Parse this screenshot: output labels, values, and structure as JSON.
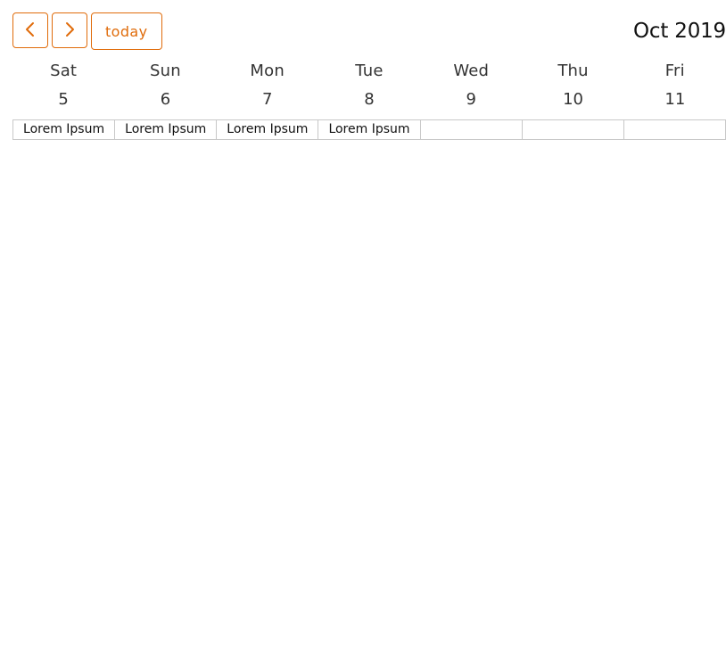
{
  "toolbar": {
    "prev_icon": "chevron-left-icon",
    "next_icon": "chevron-right-icon",
    "today_label": "today",
    "accent_color": "#e06c0b"
  },
  "title": "Oct 2019",
  "week": {
    "days": [
      {
        "name": "Sat",
        "number": "5",
        "event": "Lorem Ipsum"
      },
      {
        "name": "Sun",
        "number": "6",
        "event": "Lorem Ipsum"
      },
      {
        "name": "Mon",
        "number": "7",
        "event": "Lorem Ipsum"
      },
      {
        "name": "Tue",
        "number": "8",
        "event": "Lorem Ipsum"
      },
      {
        "name": "Wed",
        "number": "9",
        "event": ""
      },
      {
        "name": "Thu",
        "number": "10",
        "event": ""
      },
      {
        "name": "Fri",
        "number": "11",
        "event": ""
      }
    ]
  }
}
